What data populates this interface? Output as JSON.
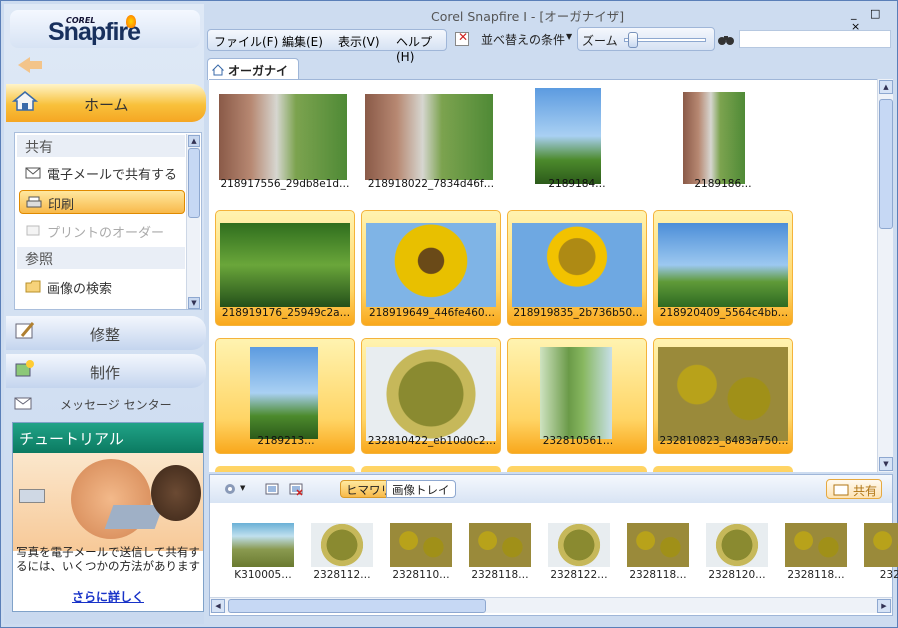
{
  "app": {
    "logo_brand": "COREL",
    "logo_name": "Snapfire",
    "window_title": "Corel Snapfire I - [オーガナイザ]",
    "window_buttons": "_ □ ×"
  },
  "sidebar": {
    "home_label": "ホーム",
    "share_header": "共有",
    "items": [
      {
        "label": "電子メールで共有する",
        "icon": "email-icon"
      },
      {
        "label": "印刷",
        "icon": "printer-icon",
        "selected": true
      },
      {
        "label": "プリントのオーダー",
        "icon": "print-order-icon",
        "disabled": true
      }
    ],
    "browse_header": "参照",
    "browse_items": [
      {
        "label": "画像の検索",
        "icon": "folder-icon"
      }
    ],
    "edit_label": "修整",
    "create_label": "制作",
    "message_center_label": "メッセージ センター"
  },
  "tutorial": {
    "title": "チュートリアル",
    "text": "写真を電子メールで送信して共有するには、いくつかの方法があります",
    "link": "さらに詳しく"
  },
  "menubar": {
    "file": "ファイル(F)",
    "edit": "編集(E)",
    "view": "表示(V)",
    "help": "ヘルプ(H)",
    "sort": "並べ替えの条件",
    "zoom": "ズーム",
    "zoom_value": 0.2,
    "search_value": ""
  },
  "tabs": {
    "organizer": "オーガナイザ"
  },
  "gallery": [
    {
      "caption": "218917556_29db8e1d…",
      "style": "street",
      "selected": false
    },
    {
      "caption": "218918022_7834d46f…",
      "style": "street",
      "selected": false
    },
    {
      "caption": "2189184…",
      "style": "tall",
      "selected": false
    },
    {
      "caption": "2189186…",
      "style": "street",
      "selected": false
    },
    {
      "caption": "218919176_25949c2a…",
      "style": "leafy",
      "selected": true
    },
    {
      "caption": "218919649_446fe460…",
      "style": "sunbig",
      "selected": true
    },
    {
      "caption": "218919835_2b736b50…",
      "style": "sunhand",
      "selected": true
    },
    {
      "caption": "218920409_5564c4bb…",
      "style": "sky2",
      "selected": true
    },
    {
      "caption": "2189213…",
      "style": "tall",
      "selected": true
    },
    {
      "caption": "232810422_eb10d0c2…",
      "style": "seed",
      "selected": true
    },
    {
      "caption": "232810561…",
      "style": "stem",
      "selected": true
    },
    {
      "caption": "232810823_8483a750…",
      "style": "dry",
      "selected": true
    }
  ],
  "tray": {
    "tab_active": "ヒマワリ",
    "tab_inactive": "画像トレイ",
    "share_label": "共有",
    "items": [
      {
        "caption": "K310005…",
        "style": "field"
      },
      {
        "caption": "2328112…",
        "style": "seed"
      },
      {
        "caption": "2328110…",
        "style": "dry"
      },
      {
        "caption": "2328118…",
        "style": "dry"
      },
      {
        "caption": "2328122…",
        "style": "seed"
      },
      {
        "caption": "2328118…",
        "style": "dry"
      },
      {
        "caption": "2328120…",
        "style": "seed"
      },
      {
        "caption": "2328118…",
        "style": "dry"
      },
      {
        "caption": "232…",
        "style": "dry"
      }
    ]
  }
}
